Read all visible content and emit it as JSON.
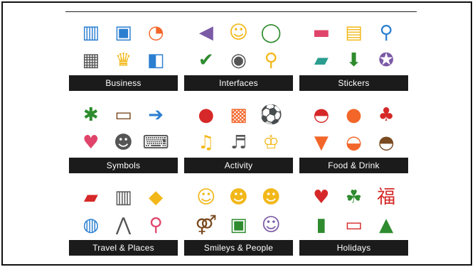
{
  "tiles": [
    {
      "label": "Business",
      "icons": [
        {
          "name": "waveform-chart-icon",
          "glyph": "▥",
          "color": "c-blue"
        },
        {
          "name": "presentation-board-icon",
          "glyph": "▣",
          "color": "c-blue"
        },
        {
          "name": "growth-chart-icon",
          "glyph": "◔",
          "color": "c-orange"
        },
        {
          "name": "calendar-check-icon",
          "glyph": "▦",
          "color": "c-gray"
        },
        {
          "name": "trophy-icon",
          "glyph": "♛",
          "color": "c-yellow"
        },
        {
          "name": "dashboard-icon",
          "glyph": "◧",
          "color": "c-blue"
        }
      ]
    },
    {
      "label": "Interfaces",
      "icons": [
        {
          "name": "speaker-icon",
          "glyph": "◀",
          "color": "c-purple"
        },
        {
          "name": "face-badge-icon",
          "glyph": "☺",
          "color": "c-yellow"
        },
        {
          "name": "ring-loader-icon",
          "glyph": "◯",
          "color": "c-green"
        },
        {
          "name": "checkmark-icon",
          "glyph": "✔",
          "color": "c-green"
        },
        {
          "name": "rss-icon",
          "glyph": "◉",
          "color": "c-gray"
        },
        {
          "name": "magnifier-icon",
          "glyph": "⚲",
          "color": "c-yellow"
        }
      ]
    },
    {
      "label": "Stickers",
      "icons": [
        {
          "name": "price-tag-icon",
          "glyph": "▬",
          "color": "c-pink"
        },
        {
          "name": "sticky-note-icon",
          "glyph": "▤",
          "color": "c-yellow"
        },
        {
          "name": "map-pin-icon",
          "glyph": "⚲",
          "color": "c-blue"
        },
        {
          "name": "ribbon-banner-icon",
          "glyph": "▰",
          "color": "c-teal"
        },
        {
          "name": "arrow-down-bookmark-icon",
          "glyph": "⬇",
          "color": "c-green"
        },
        {
          "name": "seal-badge-icon",
          "glyph": "✪",
          "color": "c-purple"
        }
      ]
    },
    {
      "label": "Symbols",
      "icons": [
        {
          "name": "fireworks-icon",
          "glyph": "✱",
          "color": "c-green"
        },
        {
          "name": "television-icon",
          "glyph": "▭",
          "color": "c-brown"
        },
        {
          "name": "right-arrow-circle-icon",
          "glyph": "➔",
          "color": "c-blue"
        },
        {
          "name": "heart-circle-icon",
          "glyph": "♥",
          "color": "c-pink"
        },
        {
          "name": "head-gears-icon",
          "glyph": "☻",
          "color": "c-gray"
        },
        {
          "name": "keyboard-icon",
          "glyph": "⌨",
          "color": "c-gray"
        }
      ]
    },
    {
      "label": "Activity",
      "icons": [
        {
          "name": "boxing-glove-icon",
          "glyph": "●",
          "color": "c-red"
        },
        {
          "name": "rubiks-cube-icon",
          "glyph": "▩",
          "color": "c-orange"
        },
        {
          "name": "soccer-ball-icon",
          "glyph": "⚽",
          "color": "c-gray"
        },
        {
          "name": "french-horn-icon",
          "glyph": "♫",
          "color": "c-yellow"
        },
        {
          "name": "grand-piano-icon",
          "glyph": "♬",
          "color": "c-gray"
        },
        {
          "name": "trophy-cup-icon",
          "glyph": "♔",
          "color": "c-yellow"
        }
      ]
    },
    {
      "label": "Food & Drink",
      "icons": [
        {
          "name": "watermelon-icon",
          "glyph": "◓",
          "color": "c-red"
        },
        {
          "name": "orange-icon",
          "glyph": "●",
          "color": "c-orange"
        },
        {
          "name": "cherries-icon",
          "glyph": "♣",
          "color": "c-red"
        },
        {
          "name": "pizza-slice-icon",
          "glyph": "▼",
          "color": "c-orange"
        },
        {
          "name": "spaghetti-icon",
          "glyph": "◒",
          "color": "c-orange"
        },
        {
          "name": "burger-icon",
          "glyph": "◓",
          "color": "c-brown"
        }
      ]
    },
    {
      "label": "Travel & Places",
      "icons": [
        {
          "name": "vintage-car-icon",
          "glyph": "▰",
          "color": "c-red"
        },
        {
          "name": "buildings-icon",
          "glyph": "▥",
          "color": "c-gray"
        },
        {
          "name": "kangaroo-sign-icon",
          "glyph": "◆",
          "color": "c-yellow"
        },
        {
          "name": "globe-icon",
          "glyph": "◍",
          "color": "c-blue"
        },
        {
          "name": "tower-bridge-icon",
          "glyph": "⋀",
          "color": "c-gray"
        },
        {
          "name": "location-pin-icon",
          "glyph": "⚲",
          "color": "c-pink"
        }
      ]
    },
    {
      "label": "Smileys & People",
      "icons": [
        {
          "name": "relieved-face-icon",
          "glyph": "☺",
          "color": "c-yellow"
        },
        {
          "name": "heart-eyes-face-icon",
          "glyph": "☻",
          "color": "c-yellow"
        },
        {
          "name": "sunglasses-face-icon",
          "glyph": "☻",
          "color": "c-yellow"
        },
        {
          "name": "couple-icon",
          "glyph": "⚤",
          "color": "c-brown"
        },
        {
          "name": "teacher-board-icon",
          "glyph": "▣",
          "color": "c-green"
        },
        {
          "name": "scientist-icon",
          "glyph": "☺",
          "color": "c-purple"
        }
      ]
    },
    {
      "label": "Holidays",
      "icons": [
        {
          "name": "heart-ornament-icon",
          "glyph": "♥",
          "color": "c-red"
        },
        {
          "name": "shamrock-icon",
          "glyph": "☘",
          "color": "c-green"
        },
        {
          "name": "chinese-character-icon",
          "glyph": "福",
          "color": "c-red"
        },
        {
          "name": "candle-icon",
          "glyph": "▮",
          "color": "c-green"
        },
        {
          "name": "earth-day-sign-icon",
          "glyph": "▭",
          "color": "c-red"
        },
        {
          "name": "christmas-tree-icon",
          "glyph": "▲",
          "color": "c-green"
        }
      ]
    }
  ]
}
